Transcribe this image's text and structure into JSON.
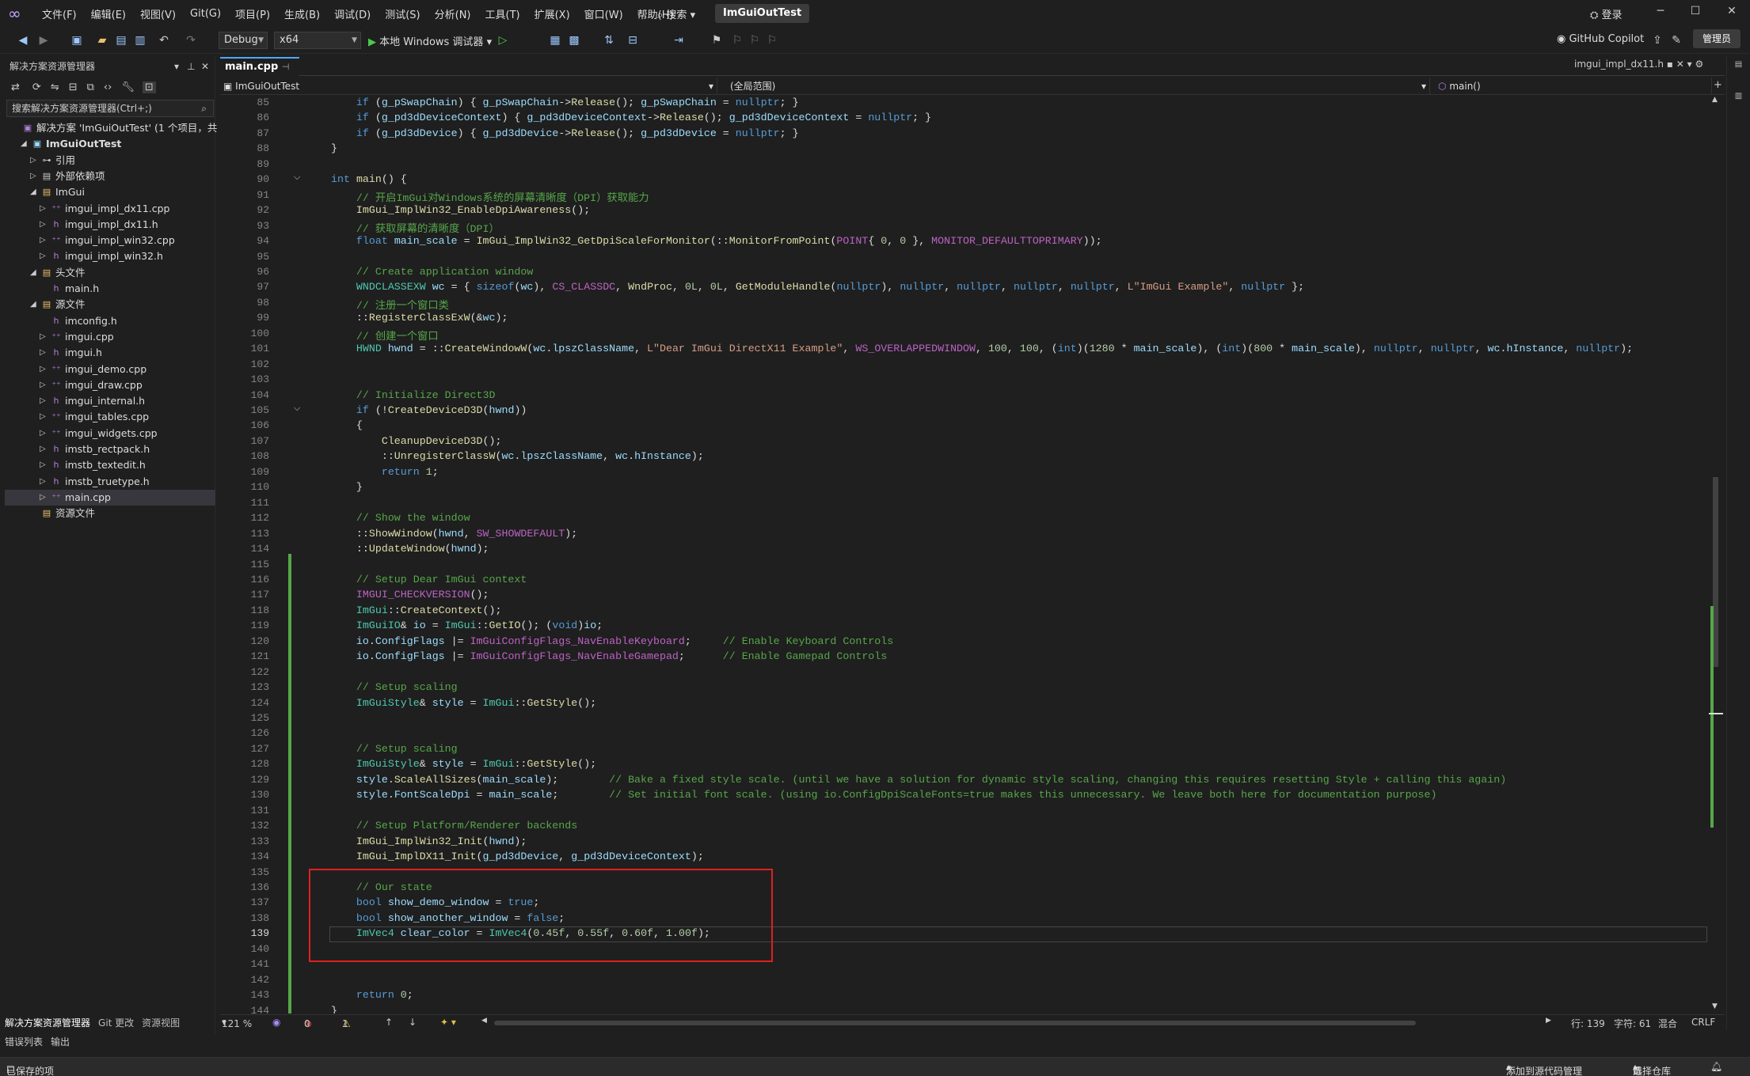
{
  "titlebar": {
    "menu": [
      "文件(F)",
      "编辑(E)",
      "视图(V)",
      "Git(G)",
      "项目(P)",
      "生成(B)",
      "调试(D)",
      "测试(S)",
      "分析(N)",
      "工具(T)",
      "扩展(X)",
      "窗口(W)",
      "帮助(H)"
    ],
    "search": "搜索",
    "solution_title": "ImGuiOutTest",
    "login": "登录"
  },
  "toolbar": {
    "config": "Debug",
    "platform": "x64",
    "run_label": "本地 Windows 调试器",
    "copilot": "GitHub Copilot",
    "admin": "管理员"
  },
  "solution_explorer": {
    "title": "解决方案资源管理器",
    "search_placeholder": "搜索解决方案资源管理器(Ctrl+;)",
    "items": [
      {
        "label": "解决方案 'ImGuiOutTest' (1 个项目，共 1",
        "icon": "solution-icon",
        "indent": 0,
        "arrow": ""
      },
      {
        "label": "ImGuiOutTest",
        "icon": "project-icon",
        "indent": 1,
        "arrow": "open",
        "bold": true
      },
      {
        "label": "引用",
        "icon": "reference-icon",
        "indent": 2,
        "arrow": "closed"
      },
      {
        "label": "外部依赖项",
        "icon": "folder-icon",
        "indent": 2,
        "arrow": "closed"
      },
      {
        "label": "ImGui",
        "icon": "filter-folder-icon",
        "indent": 2,
        "arrow": "open"
      },
      {
        "label": "imgui_impl_dx11.cpp",
        "icon": "cpp-file-icon",
        "indent": 3,
        "arrow": "closed"
      },
      {
        "label": "imgui_impl_dx11.h",
        "icon": "h-file-icon",
        "indent": 3,
        "arrow": "closed"
      },
      {
        "label": "imgui_impl_win32.cpp",
        "icon": "cpp-file-icon",
        "indent": 3,
        "arrow": "closed"
      },
      {
        "label": "imgui_impl_win32.h",
        "icon": "h-file-icon",
        "indent": 3,
        "arrow": "closed"
      },
      {
        "label": "头文件",
        "icon": "filter-folder-icon",
        "indent": 2,
        "arrow": "open"
      },
      {
        "label": "main.h",
        "icon": "h-file-icon",
        "indent": 3,
        "arrow": ""
      },
      {
        "label": "源文件",
        "icon": "filter-folder-icon",
        "indent": 2,
        "arrow": "open"
      },
      {
        "label": "imconfig.h",
        "icon": "h-file-icon",
        "indent": 3,
        "arrow": ""
      },
      {
        "label": "imgui.cpp",
        "icon": "cpp-file-icon",
        "indent": 3,
        "arrow": "closed"
      },
      {
        "label": "imgui.h",
        "icon": "h-file-icon",
        "indent": 3,
        "arrow": "closed"
      },
      {
        "label": "imgui_demo.cpp",
        "icon": "cpp-file-icon",
        "indent": 3,
        "arrow": "closed"
      },
      {
        "label": "imgui_draw.cpp",
        "icon": "cpp-file-icon",
        "indent": 3,
        "arrow": "closed"
      },
      {
        "label": "imgui_internal.h",
        "icon": "h-file-icon",
        "indent": 3,
        "arrow": "closed"
      },
      {
        "label": "imgui_tables.cpp",
        "icon": "cpp-file-icon",
        "indent": 3,
        "arrow": "closed"
      },
      {
        "label": "imgui_widgets.cpp",
        "icon": "cpp-file-icon",
        "indent": 3,
        "arrow": "closed"
      },
      {
        "label": "imstb_rectpack.h",
        "icon": "h-file-icon",
        "indent": 3,
        "arrow": "closed"
      },
      {
        "label": "imstb_textedit.h",
        "icon": "h-file-icon",
        "indent": 3,
        "arrow": "closed"
      },
      {
        "label": "imstb_truetype.h",
        "icon": "h-file-icon",
        "indent": 3,
        "arrow": "closed"
      },
      {
        "label": "main.cpp",
        "icon": "cpp-file-icon",
        "indent": 3,
        "arrow": "closed",
        "selected": true
      },
      {
        "label": "资源文件",
        "icon": "filter-folder-icon",
        "indent": 2,
        "arrow": ""
      }
    ],
    "bottom_tabs": [
      "解决方案资源管理器",
      "Git 更改",
      "资源视图"
    ]
  },
  "bottom_panel_tabs": [
    "错误列表",
    "输出"
  ],
  "editor": {
    "active_tab": "main.cpp",
    "other_tab": "imgui_impl_dx11.h",
    "nav_project": "ImGuiOutTest",
    "nav_scope": "(全局范围)",
    "nav_member": "main()",
    "current_line": 139
  },
  "code_lines": [
    {
      "n": 85,
      "h": "    <span class=\"k\">if</span> (<span class=\"v\">g_pSwapChain</span>) { <span class=\"v\">g_pSwapChain</span>-&gt;<span class=\"f\">Release</span>(); <span class=\"v\">g_pSwapChain</span> = <span class=\"k\">nullptr</span>; }"
    },
    {
      "n": 86,
      "h": "    <span class=\"k\">if</span> (<span class=\"v\">g_pd3dDeviceContext</span>) { <span class=\"v\">g_pd3dDeviceContext</span>-&gt;<span class=\"f\">Release</span>(); <span class=\"v\">g_pd3dDeviceContext</span> = <span class=\"k\">nullptr</span>; }"
    },
    {
      "n": 87,
      "h": "    <span class=\"k\">if</span> (<span class=\"v\">g_pd3dDevice</span>) { <span class=\"v\">g_pd3dDevice</span>-&gt;<span class=\"f\">Release</span>(); <span class=\"v\">g_pd3dDevice</span> = <span class=\"k\">nullptr</span>; }"
    },
    {
      "n": 88,
      "h": "}"
    },
    {
      "n": 89,
      "h": ""
    },
    {
      "n": 90,
      "h": "<span class=\"k\">int</span> <span class=\"f\">main</span>() {"
    },
    {
      "n": 91,
      "h": "    <span class=\"c\">// 开启ImGui对Windows系统的屏幕清晰度（DPI）获取能力</span>"
    },
    {
      "n": 92,
      "h": "    <span class=\"f\">ImGui_ImplWin32_EnableDpiAwareness</span>();"
    },
    {
      "n": 93,
      "h": "    <span class=\"c\">// 获取屏幕的清晰度（DPI）</span>"
    },
    {
      "n": 94,
      "h": "    <span class=\"k\">float</span> <span class=\"v\">main_scale</span> = <span class=\"f\">ImGui_ImplWin32_GetDpiScaleForMonitor</span>(::<span class=\"f\">MonitorFromPoint</span>(<span class=\"m\">POINT</span>{ <span class=\"n\">0</span>, <span class=\"n\">0</span> }, <span class=\"m\">MONITOR_DEFAULTTOPRIMARY</span>));"
    },
    {
      "n": 95,
      "h": ""
    },
    {
      "n": 96,
      "h": "    <span class=\"c\">// Create application window</span>"
    },
    {
      "n": 97,
      "h": "    <span class=\"t\">WNDCLASSEXW</span> <span class=\"v\">wc</span> = { <span class=\"k\">sizeof</span>(<span class=\"v\">wc</span>), <span class=\"m\">CS_CLASSDC</span>, <span class=\"f\">WndProc</span>, <span class=\"n\">0L</span>, <span class=\"n\">0L</span>, <span class=\"f\">GetModuleHandle</span>(<span class=\"k\">nullptr</span>), <span class=\"k\">nullptr</span>, <span class=\"k\">nullptr</span>, <span class=\"k\">nullptr</span>, <span class=\"k\">nullptr</span>, <span class=\"s\">L\"ImGui Example\"</span>, <span class=\"k\">nullptr</span> };"
    },
    {
      "n": 98,
      "h": "    <span class=\"c\">// 注册一个窗口类</span>"
    },
    {
      "n": 99,
      "h": "    ::<span class=\"f\">RegisterClassExW</span>(&amp;<span class=\"v\">wc</span>);"
    },
    {
      "n": 100,
      "h": "    <span class=\"c\">// 创建一个窗口</span>"
    },
    {
      "n": 101,
      "h": "    <span class=\"t\">HWND</span> <span class=\"v\">hwnd</span> = ::<span class=\"f\">CreateWindowW</span>(<span class=\"v\">wc</span>.<span class=\"v\">lpszClassName</span>, <span class=\"s\">L\"Dear ImGui DirectX11 Example\"</span>, <span class=\"m\">WS_OVERLAPPEDWINDOW</span>, <span class=\"n\">100</span>, <span class=\"n\">100</span>, (<span class=\"k\">int</span>)(<span class=\"n\">1280</span> * <span class=\"v\">main_scale</span>), (<span class=\"k\">int</span>)(<span class=\"n\">800</span> * <span class=\"v\">main_scale</span>), <span class=\"k\">nullptr</span>, <span class=\"k\">nullptr</span>, <span class=\"v\">wc</span>.<span class=\"v\">hInstance</span>, <span class=\"k\">nullptr</span>);"
    },
    {
      "n": 102,
      "h": ""
    },
    {
      "n": 103,
      "h": ""
    },
    {
      "n": 104,
      "h": "    <span class=\"c\">// Initialize Direct3D</span>"
    },
    {
      "n": 105,
      "h": "    <span class=\"k\">if</span> (!<span class=\"f\">CreateDeviceD3D</span>(<span class=\"v\">hwnd</span>))"
    },
    {
      "n": 106,
      "h": "    {"
    },
    {
      "n": 107,
      "h": "        <span class=\"f\">CleanupDeviceD3D</span>();"
    },
    {
      "n": 108,
      "h": "        ::<span class=\"f\">UnregisterClassW</span>(<span class=\"v\">wc</span>.<span class=\"v\">lpszClassName</span>, <span class=\"v\">wc</span>.<span class=\"v\">hInstance</span>);"
    },
    {
      "n": 109,
      "h": "        <span class=\"k\">return</span> <span class=\"n\">1</span>;"
    },
    {
      "n": 110,
      "h": "    }"
    },
    {
      "n": 111,
      "h": ""
    },
    {
      "n": 112,
      "h": "    <span class=\"c\">// Show the window</span>"
    },
    {
      "n": 113,
      "h": "    ::<span class=\"f\">ShowWindow</span>(<span class=\"v\">hwnd</span>, <span class=\"m\">SW_SHOWDEFAULT</span>);"
    },
    {
      "n": 114,
      "h": "    ::<span class=\"f\">UpdateWindow</span>(<span class=\"v\">hwnd</span>);"
    },
    {
      "n": 115,
      "h": ""
    },
    {
      "n": 116,
      "h": "    <span class=\"c\">// Setup Dear ImGui context</span>"
    },
    {
      "n": 117,
      "h": "    <span class=\"m\">IMGUI_CHECKVERSION</span>();"
    },
    {
      "n": 118,
      "h": "    <span class=\"t\">ImGui</span>::<span class=\"f\">CreateContext</span>();"
    },
    {
      "n": 119,
      "h": "    <span class=\"t\">ImGuiIO</span>&amp; <span class=\"v\">io</span> = <span class=\"t\">ImGui</span>::<span class=\"f\">GetIO</span>(); (<span class=\"k\">void</span>)<span class=\"v\">io</span>;"
    },
    {
      "n": 120,
      "h": "    <span class=\"v\">io</span>.<span class=\"v\">ConfigFlags</span> |= <span class=\"m\">ImGuiConfigFlags_NavEnableKeyboard</span>;     <span class=\"c\">// Enable Keyboard Controls</span>"
    },
    {
      "n": 121,
      "h": "    <span class=\"v\">io</span>.<span class=\"v\">ConfigFlags</span> |= <span class=\"m\">ImGuiConfigFlags_NavEnableGamepad</span>;      <span class=\"c\">// Enable Gamepad Controls</span>"
    },
    {
      "n": 122,
      "h": ""
    },
    {
      "n": 123,
      "h": "    <span class=\"c\">// Setup scaling</span>"
    },
    {
      "n": 124,
      "h": "    <span class=\"t\">ImGuiStyle</span>&amp; <span class=\"v\">style</span> = <span class=\"t\">ImGui</span>::<span class=\"f\">GetStyle</span>();"
    },
    {
      "n": 125,
      "h": ""
    },
    {
      "n": 126,
      "h": ""
    },
    {
      "n": 127,
      "h": "    <span class=\"c\">// Setup scaling</span>"
    },
    {
      "n": 128,
      "h": "    <span class=\"t\">ImGuiStyle</span>&amp; <span class=\"v\">style</span> = <span class=\"t\">ImGui</span>::<span class=\"f\">GetStyle</span>();"
    },
    {
      "n": 129,
      "h": "    <span class=\"v\">style</span>.<span class=\"f\">ScaleAllSizes</span>(<span class=\"v\">main_scale</span>);        <span class=\"c\">// Bake a fixed style scale. (until we have a solution for dynamic style scaling, changing this requires resetting Style + calling this again)</span>"
    },
    {
      "n": 130,
      "h": "    <span class=\"v\">style</span>.<span class=\"v\">FontScaleDpi</span> = <span class=\"v\">main_scale</span>;        <span class=\"c\">// Set initial font scale. (using io.ConfigDpiScaleFonts=true makes this unnecessary. We leave both here for documentation purpose)</span>"
    },
    {
      "n": 131,
      "h": ""
    },
    {
      "n": 132,
      "h": "    <span class=\"c\">// Setup Platform/Renderer backends</span>"
    },
    {
      "n": 133,
      "h": "    <span class=\"f\">ImGui_ImplWin32_Init</span>(<span class=\"v\">hwnd</span>);"
    },
    {
      "n": 134,
      "h": "    <span class=\"f\">ImGui_ImplDX11_Init</span>(<span class=\"v\">g_pd3dDevice</span>, <span class=\"v\">g_pd3dDeviceContext</span>);"
    },
    {
      "n": 135,
      "h": ""
    },
    {
      "n": 136,
      "h": "    <span class=\"c\">// Our state</span>"
    },
    {
      "n": 137,
      "h": "    <span class=\"k\">bool</span> <span class=\"v\">show_demo_window</span> = <span class=\"k\">true</span>;"
    },
    {
      "n": 138,
      "h": "    <span class=\"k\">bool</span> <span class=\"v\">show_another_window</span> = <span class=\"k\">false</span>;"
    },
    {
      "n": 139,
      "h": "    <span class=\"t\">ImVec4</span> <span class=\"v\">clear_color</span> = <span class=\"t\">ImVec4</span>(<span class=\"n\">0.45f</span>, <span class=\"n\">0.55f</span>, <span class=\"n\">0.60f</span>, <span class=\"n\">1.00f</span>);"
    },
    {
      "n": 140,
      "h": ""
    },
    {
      "n": 141,
      "h": ""
    },
    {
      "n": 142,
      "h": ""
    },
    {
      "n": 143,
      "h": "    <span class=\"k\">return</span> <span class=\"n\">0</span>;"
    },
    {
      "n": 144,
      "h": "}"
    }
  ],
  "editor_status": {
    "zoom": "121 %",
    "errors": "0",
    "warnings": "1",
    "line": "行: 139",
    "col": "字符: 61",
    "mixed": "混合",
    "eol": "CRLF"
  },
  "statusbar": {
    "saved": "已保存的项",
    "source_control": "添加到源代码管理",
    "repo": "选择仓库"
  }
}
